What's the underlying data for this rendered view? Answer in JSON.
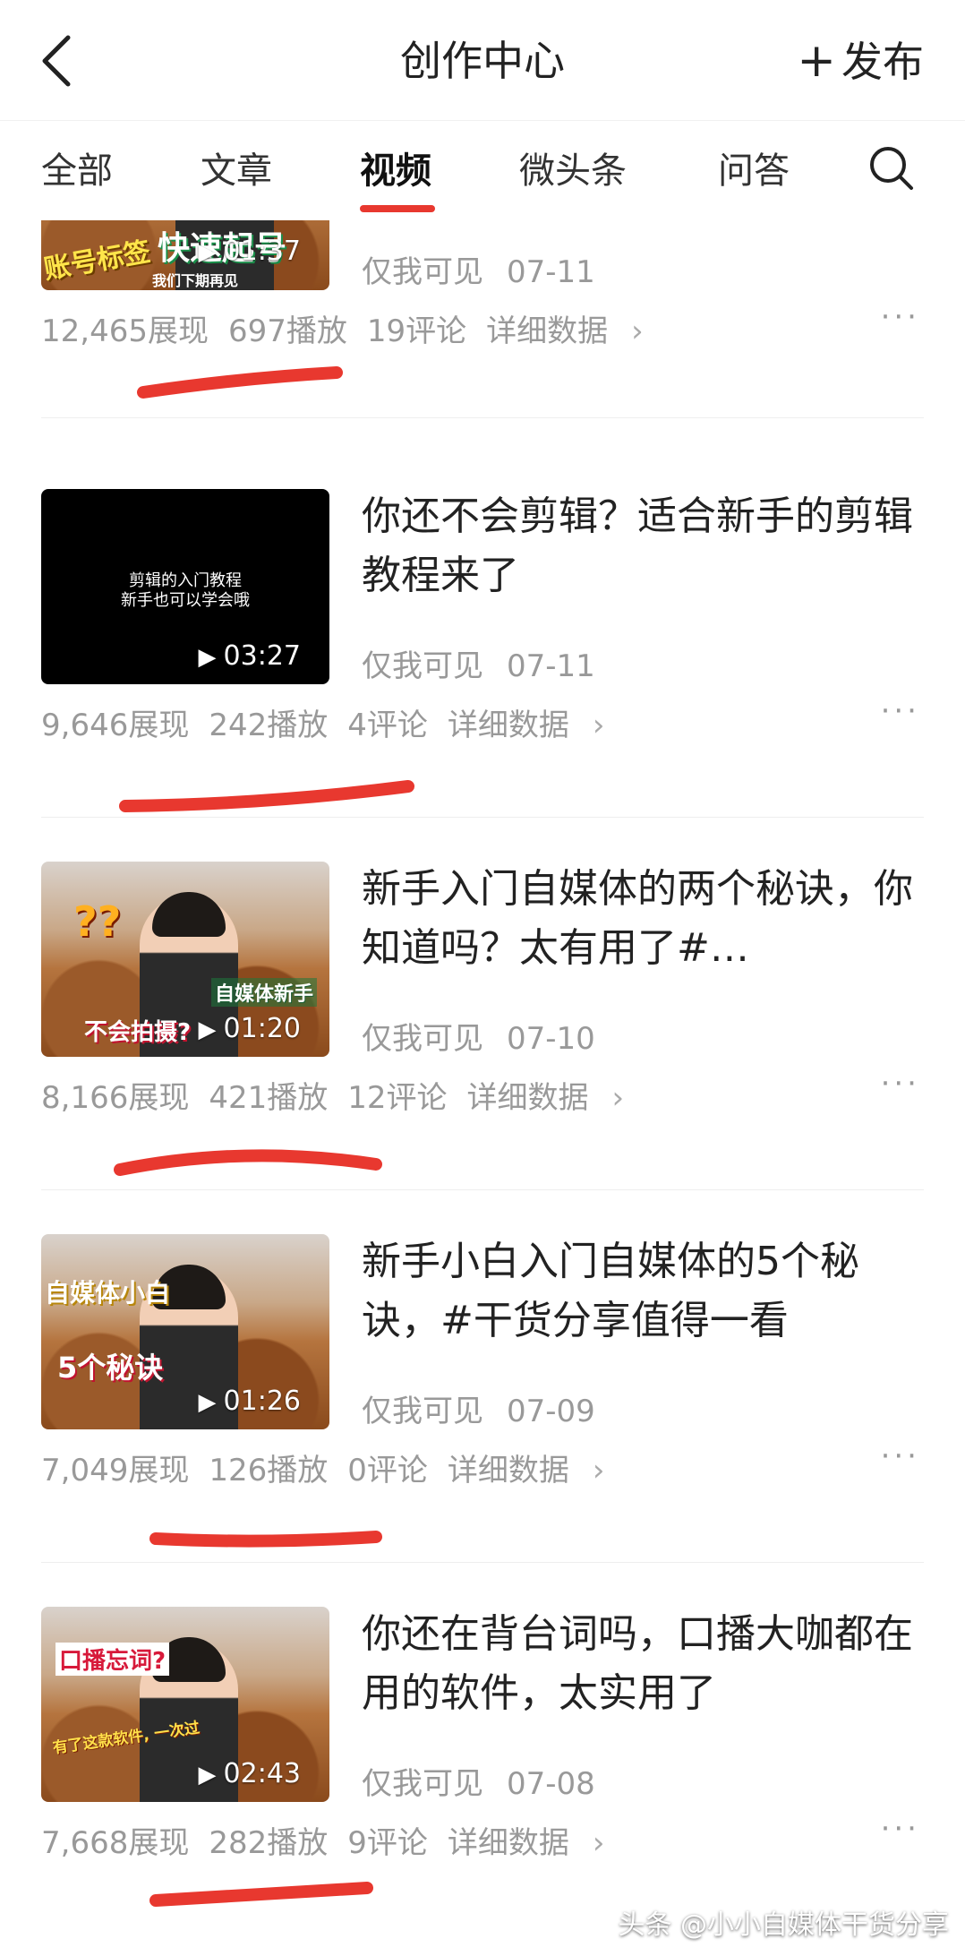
{
  "header": {
    "title": "创作中心",
    "publish_plus": "+",
    "publish_label": "发布"
  },
  "tabs": [
    {
      "label": "全部"
    },
    {
      "label": "文章"
    },
    {
      "label": "视频"
    },
    {
      "label": "微头条"
    },
    {
      "label": "问答"
    }
  ],
  "active_tab": "视频",
  "colors": {
    "accent": "#e8382f",
    "muted": "#999999"
  },
  "items": [
    {
      "title": "",
      "thumb_caption_1": "账号标签",
      "thumb_caption_2": "快速起号",
      "thumb_caption_3": "我们下期再见",
      "duration": "01:37",
      "visibility": "仅我可见",
      "date": "07-11",
      "impressions": "12,465展现",
      "plays": "697播放",
      "comments": "19评论",
      "details": "详细数据"
    },
    {
      "title": "你还不会剪辑？适合新手的剪辑教程来了",
      "thumb_caption_1": "剪辑的入门教程",
      "thumb_caption_2": "新手也可以学会哦",
      "duration": "03:27",
      "visibility": "仅我可见",
      "date": "07-11",
      "impressions": "9,646展现",
      "plays": "242播放",
      "comments": "4评论",
      "details": "详细数据"
    },
    {
      "title": "新手入门自媒体的两个秘诀，你知道吗？太有用了#…",
      "thumb_caption_1": "??",
      "thumb_caption_2": "自媒体新手",
      "thumb_caption_3": "不会拍摄?",
      "duration": "01:20",
      "visibility": "仅我可见",
      "date": "07-10",
      "impressions": "8,166展现",
      "plays": "421播放",
      "comments": "12评论",
      "details": "详细数据"
    },
    {
      "title": "新手小白入门自媒体的5个秘诀，#干货分享值得一看",
      "thumb_caption_1": "自媒体小白",
      "thumb_caption_2": "5个秘诀",
      "duration": "01:26",
      "visibility": "仅我可见",
      "date": "07-09",
      "impressions": "7,049展现",
      "plays": "126播放",
      "comments": "0评论",
      "details": "详细数据"
    },
    {
      "title": "你还在背台词吗，口播大咖都在用的软件，太实用了",
      "thumb_caption_1": "口播忘词?",
      "thumb_caption_2": "有了这款软件, 一次过",
      "duration": "02:43",
      "visibility": "仅我可见",
      "date": "07-08",
      "impressions": "7,668展现",
      "plays": "282播放",
      "comments": "9评论",
      "details": "详细数据"
    }
  ],
  "watermark": "头条 @小小自媒体干货分享"
}
